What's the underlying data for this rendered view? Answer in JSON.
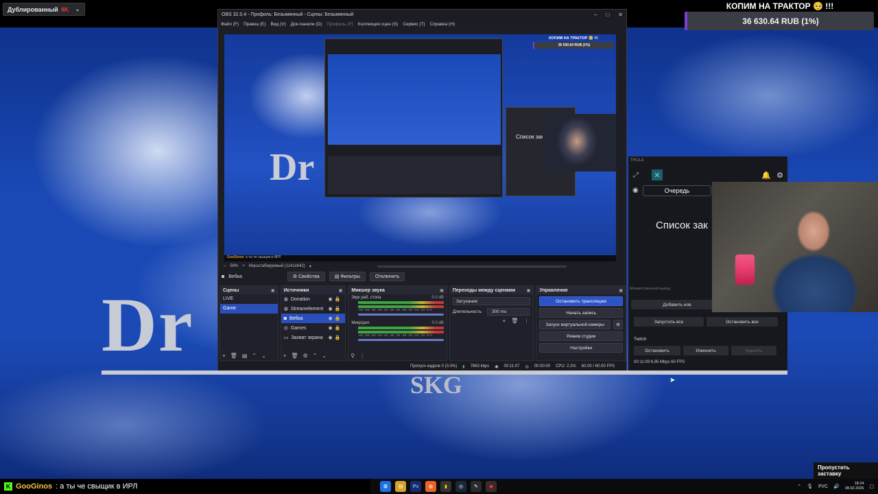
{
  "overlay": {
    "dub_label": "Дублированный",
    "dub_quality": "4K",
    "goal_title": "КОПИМ НА ТРАКТОР 🥺 !!!",
    "goal_amount": "36 630.64 RUB (1%)",
    "skip_label": "Пропустить заставку"
  },
  "background": {
    "logo_text": "Dr",
    "sub_text": "SKG"
  },
  "obs": {
    "title": "OBS 32.0.4 - Профиль: Безымянный - Сцены: Безымянный",
    "menu": [
      "Файл (F)",
      "Правка (E)",
      "Вид (V)",
      "Док-панели (D)",
      "Профиль (P)",
      "Коллекция сцен (S)",
      "Сервис (T)",
      "Справка (H)"
    ],
    "menu_disabled": "Профиль (P)",
    "preview_chat": {
      "name": "GooGinos",
      "text": ": а ты че свыщик в ИРЛ"
    },
    "nested_goal": {
      "title": "КОПИМ НА ТРАКТОР 🥺 !!!",
      "amount": "36 630.64 RUB (1%)"
    },
    "nested_list": "Список зак",
    "zoom": {
      "percent": "59%",
      "mode": "Масштабируемый (1141x642)"
    },
    "selected_source": "Вебка",
    "src_buttons": {
      "props": "Свойства",
      "filters": "Фильтры",
      "disable": "Отключить"
    },
    "docks": {
      "scenes": {
        "title": "Сцены",
        "items": [
          "LIVE",
          "Game"
        ],
        "selected": 1
      },
      "sources": {
        "title": "Источники",
        "items": [
          "Donation",
          "Streamelement",
          "Вебка",
          "Games",
          "Захват экрана"
        ],
        "selected": 2
      },
      "mixer": {
        "title": "Микшер звука",
        "channels": [
          {
            "name": "Звук раб. стола",
            "db": "0.0 dB"
          },
          {
            "name": "Микр/доп",
            "db": "0.0 dB"
          }
        ],
        "ticks": "-60 -55 -50 -45 -40 -35 -30 -25 -20 -15 -10 -5 0"
      },
      "transitions": {
        "title": "Переходы между сценами",
        "selected": "Затухание",
        "duration_label": "Длительность",
        "duration_value": "300 ms"
      },
      "controls": {
        "title": "Управление",
        "stop_stream": "Остановить трансляцию",
        "start_rec": "Начать запись",
        "virtual_cam": "Запуск виртуальной камеры",
        "studio_mode": "Режим студии",
        "settings": "Настройки"
      }
    },
    "status": {
      "dropped": "Пропуск кадров 0 (0.0%)",
      "kbps": "7663 kbps",
      "time": "00:11:07",
      "rec": "00:00:00",
      "cpu": "CPU: 2.2%",
      "fps": "60.00 / 60.00 FPS"
    }
  },
  "multistream": {
    "brand": "TRULA",
    "queue_tab": "Очередь",
    "list_title": "Список зак",
    "output_label": "Множественный вывод",
    "add_button": "Добавить нов",
    "start_all": "Запустить все",
    "stop_all": "Остановить все",
    "platform": "Twitch",
    "stop": "Остановить",
    "edit": "Изменить",
    "delete": "Удалить",
    "stats": "00:11:09  6.95 Mbps  60 FPS"
  },
  "chat": {
    "name": "GooGinos",
    "text": ": а ты че свыщик в ИРЛ"
  },
  "taskbar": {
    "lang": "РУС",
    "time": "18:24",
    "date": "28.02.2026"
  }
}
